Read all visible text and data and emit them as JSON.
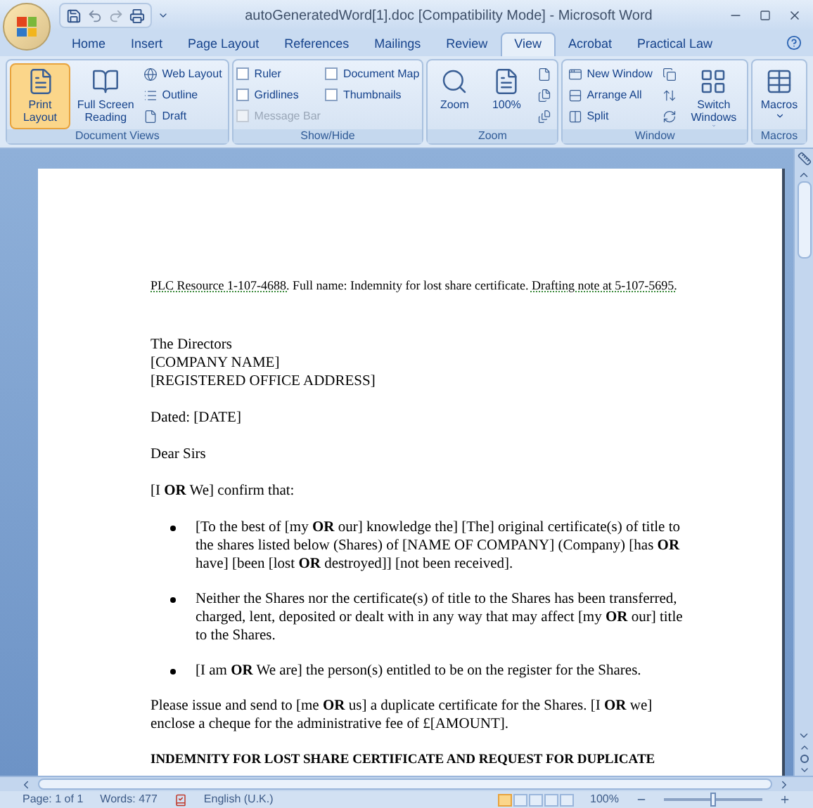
{
  "window": {
    "title": "autoGeneratedWord[1].doc [Compatibility Mode] - Microsoft Word"
  },
  "tabs": [
    {
      "label": "Home",
      "selected": false
    },
    {
      "label": "Insert",
      "selected": false
    },
    {
      "label": "Page Layout",
      "selected": false
    },
    {
      "label": "References",
      "selected": false
    },
    {
      "label": "Mailings",
      "selected": false
    },
    {
      "label": "Review",
      "selected": false
    },
    {
      "label": "View",
      "selected": true
    },
    {
      "label": "Acrobat",
      "selected": false
    },
    {
      "label": "Practical Law",
      "selected": false
    }
  ],
  "ribbon": {
    "groups": [
      {
        "label": "Document Views",
        "items": [
          {
            "kind": "large",
            "label": "Print Layout",
            "selected": true
          },
          {
            "kind": "large",
            "label": "Full Screen Reading",
            "selected": false
          },
          {
            "kind": "small",
            "label": "Web Layout",
            "selected": false
          },
          {
            "kind": "small",
            "label": "Outline",
            "selected": false
          },
          {
            "kind": "small",
            "label": "Draft",
            "selected": false
          }
        ]
      },
      {
        "label": "Show/Hide",
        "items": [
          {
            "kind": "check",
            "label": "Ruler",
            "checked": false,
            "disabled": false
          },
          {
            "kind": "check",
            "label": "Gridlines",
            "checked": false,
            "disabled": false
          },
          {
            "kind": "check",
            "label": "Message Bar",
            "checked": false,
            "disabled": true
          },
          {
            "kind": "check",
            "label": "Document Map",
            "checked": false,
            "disabled": false
          },
          {
            "kind": "check",
            "label": "Thumbnails",
            "checked": false,
            "disabled": false
          }
        ]
      },
      {
        "label": "Zoom",
        "items": [
          {
            "kind": "large",
            "label": "Zoom",
            "selected": false
          },
          {
            "kind": "large",
            "label": "100%",
            "selected": false
          },
          {
            "kind": "icon"
          },
          {
            "kind": "icon"
          },
          {
            "kind": "icon"
          }
        ]
      },
      {
        "label": "Window",
        "items": [
          {
            "kind": "small",
            "label": "New Window",
            "selected": false
          },
          {
            "kind": "small",
            "label": "Arrange All",
            "selected": false
          },
          {
            "kind": "small",
            "label": "Split",
            "selected": false
          },
          {
            "kind": "icon"
          },
          {
            "kind": "icon"
          },
          {
            "kind": "icon"
          },
          {
            "kind": "large",
            "label": "Switch Windows",
            "selected": false,
            "dropdown": true
          }
        ]
      },
      {
        "label": "Macros",
        "items": [
          {
            "kind": "large",
            "label": "Macros",
            "selected": false,
            "dropdown": true
          }
        ]
      }
    ]
  },
  "document": {
    "blocks": [
      {
        "kind": "note",
        "parts": [
          {
            "text": "PLC Resource 1-107-4688.",
            "underlined": true
          },
          {
            "text": "Full name: Indemnity for lost share certificate.",
            "underlined": false
          },
          {
            "text": "Drafting note at 5-107-5695.",
            "underlined": true
          }
        ]
      },
      {
        "kind": "lines",
        "lines": [
          "The Directors",
          "[COMPANY NAME]",
          "[REGISTERED OFFICE ADDRESS]"
        ]
      },
      {
        "kind": "para",
        "text": "Dated: [DATE]"
      },
      {
        "kind": "para",
        "text": "Dear Sirs"
      },
      {
        "kind": "para",
        "text": "[I **OR** We] confirm that:"
      },
      {
        "kind": "bullets",
        "items": [
          "[To the best of [my **OR** our] knowledge the] [The] original certificate(s) of title to the shares listed below (Shares) of [NAME OF COMPANY] (Company) [has **OR** have] [been [lost **OR** destroyed]] [not been received].",
          "Neither the Shares nor the certificate(s) of title to the Shares has been transferred, charged, lent, deposited or dealt with in any way that may affect [my **OR** our] title to the Shares.",
          "[I am **OR** We are] the person(s) entitled to be on the register for the Shares."
        ]
      },
      {
        "kind": "para",
        "text": "Please issue and send to [me **OR** us] a duplicate certificate for the Shares. [I **OR** we] enclose a cheque for the administrative fee of £[AMOUNT]."
      },
      {
        "kind": "heading",
        "text": "INDEMNITY FOR LOST SHARE CERTIFICATE AND REQUEST FOR DUPLICATE"
      }
    ]
  },
  "status_bar": {
    "page": "Page: 1 of 1",
    "words": "Words: 477",
    "language": "English (U.K.)",
    "zoom": "100%",
    "zoom_slider": {
      "level": 0.5
    },
    "views": [
      {
        "selected": true
      },
      {
        "selected": false
      },
      {
        "selected": false
      },
      {
        "selected": false
      },
      {
        "selected": false
      }
    ]
  }
}
